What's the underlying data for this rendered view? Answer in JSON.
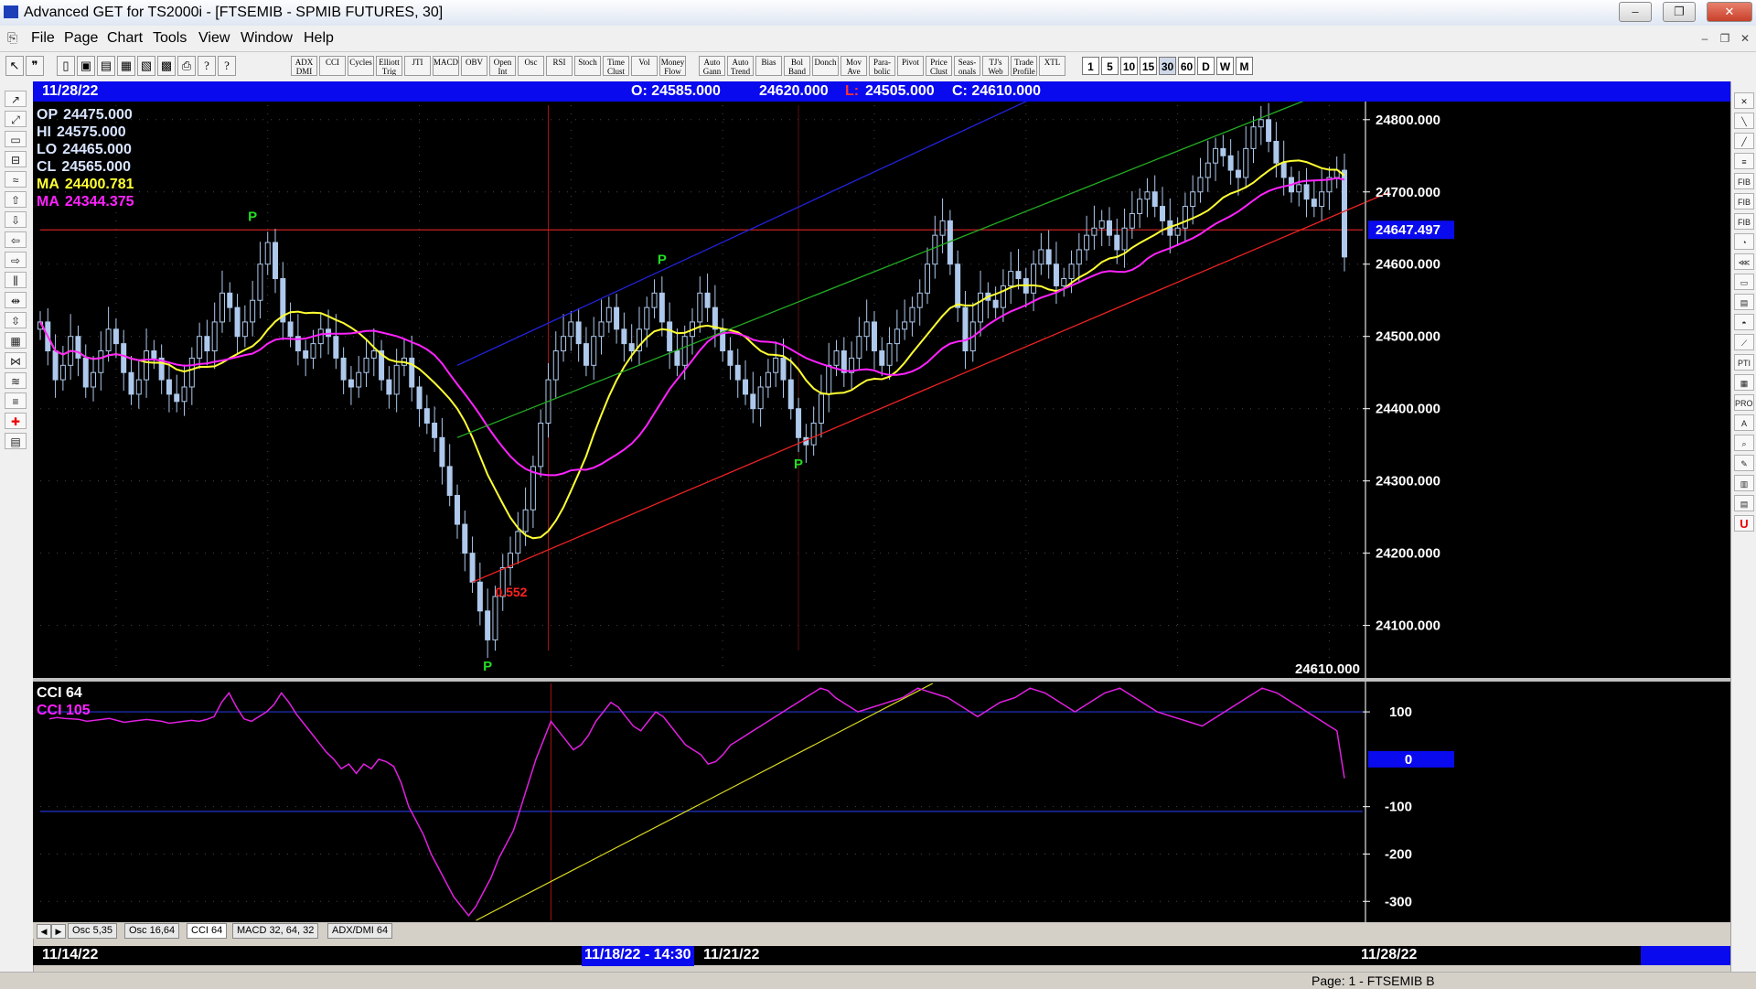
{
  "window": {
    "title": "Advanced GET for TS2000i - [FTSEMIB - SPMIB FUTURES, 30]",
    "minimize": "–",
    "restore": "❐",
    "close": "✕"
  },
  "menu": [
    "File",
    "Page",
    "Chart",
    "Tools",
    "View",
    "Window",
    "Help"
  ],
  "mdi": {
    "minimize": "–",
    "restore": "❐",
    "close": "✕"
  },
  "toolbar": {
    "icons": [
      {
        "name": "pointer-icon",
        "glyph": "↖"
      },
      {
        "name": "quote-icon",
        "glyph": "❞"
      },
      {
        "name": "new-page-icon",
        "glyph": "▯"
      },
      {
        "name": "open-icon",
        "glyph": "▣"
      },
      {
        "name": "save-icon",
        "glyph": "▤"
      },
      {
        "name": "copy-icon",
        "glyph": "▦"
      },
      {
        "name": "paste-icon",
        "glyph": "▧"
      },
      {
        "name": "grid-icon",
        "glyph": "▩"
      },
      {
        "name": "print-icon",
        "glyph": "⎙"
      },
      {
        "name": "hint-icon",
        "glyph": "?"
      },
      {
        "name": "help-icon",
        "glyph": "?"
      }
    ],
    "studies": [
      "ADX DMI",
      "CCI",
      "Cycles",
      "Elliott Trig",
      "JTI",
      "MACD",
      "OBV",
      "Open Int",
      "Osc",
      "RSI",
      "Stoch",
      "Time Clust",
      "Vol",
      "Money Flow",
      "Auto Gann",
      "Auto Trend",
      "Bias",
      "Bol Band",
      "Donch",
      "Mov Ave",
      "Para-bolic",
      "Pivot",
      "Price Clust",
      "Seas-onals",
      "TJ's Web",
      "Trade Profile",
      "XTL"
    ],
    "periods": [
      "1",
      "5",
      "10",
      "15",
      "30",
      "60",
      "D",
      "W",
      "M"
    ],
    "selected_period": "30"
  },
  "header": {
    "date": "11/28/22",
    "open": "O: 24585.000",
    "high": "24620.000",
    "low_label": "L:",
    "low": "24505.000",
    "close": "C: 24610.000"
  },
  "readout": [
    {
      "label": "OP",
      "value": "24475.000",
      "color": "#d8e4ff"
    },
    {
      "label": "HI",
      "value": "24575.000",
      "color": "#d8e4ff"
    },
    {
      "label": "LO",
      "value": "24465.000",
      "color": "#d8e4ff"
    },
    {
      "label": "CL",
      "value": "24565.000",
      "color": "#d8e4ff"
    },
    {
      "label": "MA",
      "value": "24400.781",
      "color": "#ffff33"
    },
    {
      "label": "MA",
      "value": "24344.375",
      "color": "#ff22ff"
    }
  ],
  "chart_data": [
    {
      "type": "candlestick",
      "title": "",
      "ylim": [
        24040,
        24820
      ],
      "yticks": [
        "24800.000",
        "24700.000",
        "24600.000",
        "24500.000",
        "24400.000",
        "24300.000",
        "24200.000",
        "24100.000"
      ],
      "ytick_values": [
        24800,
        24700,
        24600,
        24500,
        24400,
        24300,
        24200,
        24100
      ],
      "price_marker": {
        "value": 24647.497,
        "label": "24647.497",
        "color": "#ff2222"
      },
      "last_price_label": "24610.000",
      "closes": [
        24520,
        24480,
        24440,
        24460,
        24500,
        24470,
        24430,
        24450,
        24480,
        24510,
        24490,
        24450,
        24420,
        24440,
        24480,
        24470,
        24440,
        24420,
        24410,
        24430,
        24470,
        24500,
        24480,
        24520,
        24560,
        24540,
        24500,
        24520,
        24550,
        24600,
        24630,
        24580,
        24520,
        24500,
        24480,
        24470,
        24490,
        24510,
        24500,
        24470,
        24440,
        24430,
        24450,
        24470,
        24480,
        24440,
        24420,
        24460,
        24470,
        24430,
        24400,
        24380,
        24360,
        24320,
        24280,
        24240,
        24200,
        24160,
        24120,
        24080,
        24140,
        24180,
        24200,
        24230,
        24260,
        24320,
        24380,
        24440,
        24480,
        24500,
        24520,
        24490,
        24460,
        24500,
        24520,
        24540,
        24510,
        24490,
        24480,
        24510,
        24540,
        24560,
        24520,
        24480,
        24460,
        24500,
        24520,
        24560,
        24540,
        24510,
        24480,
        24460,
        24440,
        24420,
        24400,
        24430,
        24450,
        24470,
        24440,
        24400,
        24360,
        24350,
        24380,
        24420,
        24460,
        24480,
        24450,
        24470,
        24500,
        24520,
        24480,
        24460,
        24490,
        24510,
        24520,
        24540,
        24560,
        24600,
        24640,
        24660,
        24600,
        24540,
        24480,
        24520,
        24560,
        24550,
        24540,
        24570,
        24590,
        24580,
        24560,
        24600,
        24620,
        24600,
        24570,
        24580,
        24600,
        24620,
        24640,
        24650,
        24660,
        24640,
        24620,
        24650,
        24670,
        24690,
        24700,
        24680,
        24660,
        24640,
        24650,
        24680,
        24700,
        24720,
        24740,
        24760,
        24750,
        24730,
        24720,
        24760,
        24790,
        24800,
        24770,
        24740,
        24720,
        24700,
        24710,
        24690,
        24680,
        24700,
        24720,
        24730,
        24610
      ],
      "ma_fast": {
        "name": "MA",
        "color": "#ffff33"
      },
      "ma_slow": {
        "name": "MA",
        "color": "#ff22ff"
      },
      "pivots": [
        {
          "label": "P",
          "index": 28,
          "value": 24650,
          "pos": "above"
        },
        {
          "label": "P",
          "index": 59,
          "value": 24060,
          "pos": "below"
        },
        {
          "label": "P",
          "index": 82,
          "value": 24590,
          "pos": "above"
        },
        {
          "label": "P",
          "index": 100,
          "value": 24340,
          "pos": "below"
        }
      ],
      "ratio_label": {
        "text": "0.552",
        "index": 60,
        "value": 24140,
        "color": "#ff2222"
      },
      "trendlines": [
        {
          "color": "#2222dd",
          "from": [
            55,
            24460
          ],
          "to": [
            131,
            24830
          ]
        },
        {
          "color": "#22aa22",
          "from": [
            55,
            24360
          ],
          "to": [
            170,
            24840
          ]
        },
        {
          "color": "#ee2222",
          "from": [
            57,
            24160
          ],
          "to": [
            178,
            24700
          ]
        }
      ],
      "hline": {
        "value": 24647.497,
        "color": "#cc2222"
      },
      "vlines": [
        {
          "index": 67,
          "color": "#aa1111"
        },
        {
          "index": 100,
          "color": "#551111"
        }
      ]
    },
    {
      "type": "line",
      "title": "CCI 64",
      "series": [
        {
          "name": "CCI 64",
          "color": "#e020e0"
        }
      ],
      "ylim": [
        -340,
        160
      ],
      "yticks": [
        "100",
        "-100",
        "-200",
        "-300"
      ],
      "ytick_values": [
        100,
        -100,
        -200,
        -300
      ],
      "zero_marker": {
        "value": 0,
        "label": "0"
      },
      "value_label": "CCI  105",
      "values": [
        85,
        88,
        86,
        85,
        84,
        80,
        82,
        84,
        86,
        82,
        78,
        80,
        82,
        84,
        82,
        80,
        76,
        78,
        80,
        82,
        80,
        84,
        90,
        120,
        140,
        110,
        85,
        80,
        90,
        100,
        115,
        140,
        120,
        95,
        75,
        55,
        35,
        15,
        0,
        -20,
        -10,
        -30,
        -10,
        -20,
        0,
        -5,
        -15,
        -50,
        -100,
        -130,
        -160,
        -200,
        -230,
        -260,
        -290,
        -310,
        -330,
        -310,
        -280,
        -250,
        -210,
        -180,
        -150,
        -100,
        -50,
        0,
        40,
        80,
        60,
        40,
        20,
        30,
        50,
        80,
        100,
        120,
        110,
        90,
        70,
        60,
        80,
        100,
        90,
        70,
        50,
        30,
        20,
        10,
        -10,
        -5,
        10,
        30,
        40,
        50,
        60,
        70,
        80,
        90,
        100,
        110,
        120,
        130,
        140,
        150,
        145,
        130,
        120,
        110,
        100,
        105,
        110,
        115,
        120,
        125,
        130,
        140,
        150,
        145,
        140,
        135,
        130,
        120,
        110,
        100,
        90,
        100,
        110,
        120,
        125,
        130,
        140,
        150,
        145,
        140,
        130,
        120,
        110,
        100,
        110,
        120,
        130,
        140,
        145,
        150,
        140,
        130,
        120,
        110,
        100,
        95,
        90,
        85,
        80,
        75,
        70,
        80,
        90,
        100,
        110,
        120,
        130,
        140,
        150,
        145,
        140,
        130,
        120,
        110,
        100,
        90,
        80,
        70,
        60,
        -40
      ],
      "trendline": {
        "color": "#dddd22",
        "from": [
          57,
          -340
        ],
        "to": [
          118,
          160
        ]
      },
      "hlines": [
        {
          "value": 100,
          "color": "#2233cc"
        },
        {
          "value": -110,
          "color": "#2233cc"
        }
      ]
    }
  ],
  "tabs": [
    "Osc 5,35",
    "Osc 16,64",
    "CCI 64",
    "MACD 32, 64, 32",
    "ADX/DMI 64"
  ],
  "selected_tab": "CCI 64",
  "date_axis": {
    "start": "11/14/22",
    "cursor": "11/18/22 - 14:30",
    "mid": "11/21/22",
    "end": "11/28/22"
  },
  "status": "Page: 1 - FTSEMIB B",
  "left_tools": [
    "↗",
    "⤢",
    "▭",
    "⊟",
    "≈",
    "⇧",
    "⇩",
    "⇦",
    "⇨",
    "⫼",
    "⇹",
    "⇳",
    "▦",
    "⋈",
    "≋",
    "≡",
    "✚",
    "▤"
  ],
  "right_tools": [
    "✕",
    "╲",
    "╱",
    "≡",
    "FIB",
    "FIB",
    "FIB",
    "◔",
    "⋘",
    "▭",
    "▤",
    "◓",
    "⟋",
    "PTI",
    "▦",
    "PROB",
    "A",
    "⌕",
    "✎",
    "▥",
    "▤",
    "U"
  ]
}
